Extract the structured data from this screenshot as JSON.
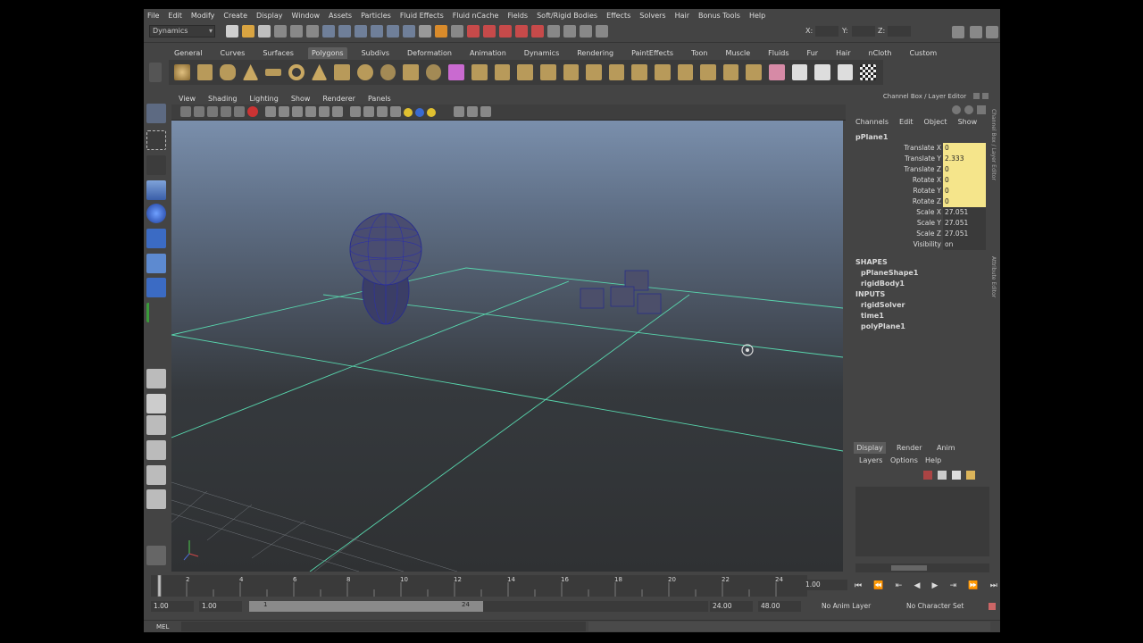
{
  "menubar": [
    "File",
    "Edit",
    "Modify",
    "Create",
    "Display",
    "Window",
    "Assets",
    "Particles",
    "Fluid Effects",
    "Fluid nCache",
    "Fields",
    "Soft/Rigid Bodies",
    "Effects",
    "Solvers",
    "Hair",
    "Bonus Tools",
    "Help"
  ],
  "status": {
    "menu_set": "Dynamics",
    "x_label": "X:",
    "y_label": "Y:",
    "z_label": "Z:"
  },
  "shelf_tabs": [
    "General",
    "Curves",
    "Surfaces",
    "Polygons",
    "Subdivs",
    "Deformation",
    "Animation",
    "Dynamics",
    "Rendering",
    "PaintEffects",
    "Toon",
    "Muscle",
    "Fluids",
    "Fur",
    "Hair",
    "nCloth",
    "Custom"
  ],
  "active_shelf": "Polygons",
  "panel_menu": [
    "View",
    "Shading",
    "Lighting",
    "Show",
    "Renderer",
    "Panels"
  ],
  "channel_box": {
    "title": "Channel Box / Layer Editor",
    "menu": [
      "Channels",
      "Edit",
      "Object",
      "Show"
    ],
    "object": "pPlane1",
    "attributes": [
      {
        "label": "Translate X",
        "value": "0",
        "keyed": true
      },
      {
        "label": "Translate Y",
        "value": "2.333",
        "keyed": true
      },
      {
        "label": "Translate Z",
        "value": "0",
        "keyed": true
      },
      {
        "label": "Rotate X",
        "value": "0",
        "keyed": true
      },
      {
        "label": "Rotate Y",
        "value": "0",
        "keyed": true
      },
      {
        "label": "Rotate Z",
        "value": "0",
        "keyed": true
      },
      {
        "label": "Scale X",
        "value": "27.051",
        "keyed": false
      },
      {
        "label": "Scale Y",
        "value": "27.051",
        "keyed": false
      },
      {
        "label": "Scale Z",
        "value": "27.051",
        "keyed": false
      },
      {
        "label": "Visibility",
        "value": "on",
        "keyed": false
      }
    ],
    "shapes_header": "SHAPES",
    "shapes": [
      "pPlaneShape1",
      "rigidBody1"
    ],
    "inputs_header": "INPUTS",
    "inputs": [
      "rigidSolver",
      "time1",
      "polyPlane1"
    ],
    "side_tabs": [
      "Channel Box / Layer Editor",
      "Attribute Editor"
    ]
  },
  "layer_editor": {
    "tabs": [
      "Display",
      "Render",
      "Anim"
    ],
    "menu": [
      "Layers",
      "Options",
      "Help"
    ]
  },
  "timeline": {
    "ticks": [
      "2",
      "4",
      "6",
      "8",
      "10",
      "12",
      "14",
      "16",
      "18",
      "20",
      "22",
      "24"
    ],
    "current_frame": "1.00"
  },
  "range": {
    "start": "1.00",
    "playback_start": "1.00",
    "slider_start": "1",
    "slider_end": "24",
    "playback_end": "24.00",
    "end": "48.00",
    "anim_layer": "No Anim Layer",
    "character_set": "No Character Set"
  },
  "cmdline": {
    "label": "MEL"
  },
  "colors": {
    "keyed": "#f5e58b",
    "grid": "#4fd3a8",
    "object": "#3a3f6e"
  }
}
